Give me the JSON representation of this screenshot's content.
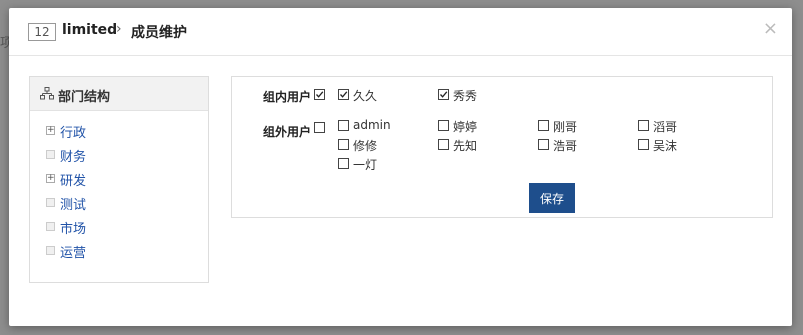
{
  "backdrop": {
    "ghost_text": "项目"
  },
  "header": {
    "project_id": "12",
    "project_name": "limited",
    "separator": "›",
    "title": "成员维护",
    "close": "×"
  },
  "departments": {
    "heading": "部门结构",
    "items": [
      {
        "label": "行政",
        "expandable": true
      },
      {
        "label": "财务",
        "expandable": false
      },
      {
        "label": "研发",
        "expandable": true
      },
      {
        "label": "测试",
        "expandable": false
      },
      {
        "label": "市场",
        "expandable": false
      },
      {
        "label": "运营",
        "expandable": false
      }
    ]
  },
  "members": {
    "inner_label": "组内用户",
    "inner_all_checked": true,
    "inner_users": [
      {
        "name": "久久",
        "checked": true
      },
      {
        "name": "秀秀",
        "checked": true
      }
    ],
    "outer_label": "组外用户",
    "outer_all_checked": false,
    "outer_users": [
      {
        "name": "admin",
        "checked": false
      },
      {
        "name": "婷婷",
        "checked": false
      },
      {
        "name": "刚哥",
        "checked": false
      },
      {
        "name": "滔哥",
        "checked": false
      },
      {
        "name": "修修",
        "checked": false
      },
      {
        "name": "先知",
        "checked": false
      },
      {
        "name": "浩哥",
        "checked": false
      },
      {
        "name": "吴沫",
        "checked": false
      },
      {
        "name": "一灯",
        "checked": false
      }
    ],
    "save_label": "保存"
  },
  "colors": {
    "link": "#2153a8",
    "primary_button": "#1e4e8c",
    "overlay": "#8e8e8e"
  }
}
